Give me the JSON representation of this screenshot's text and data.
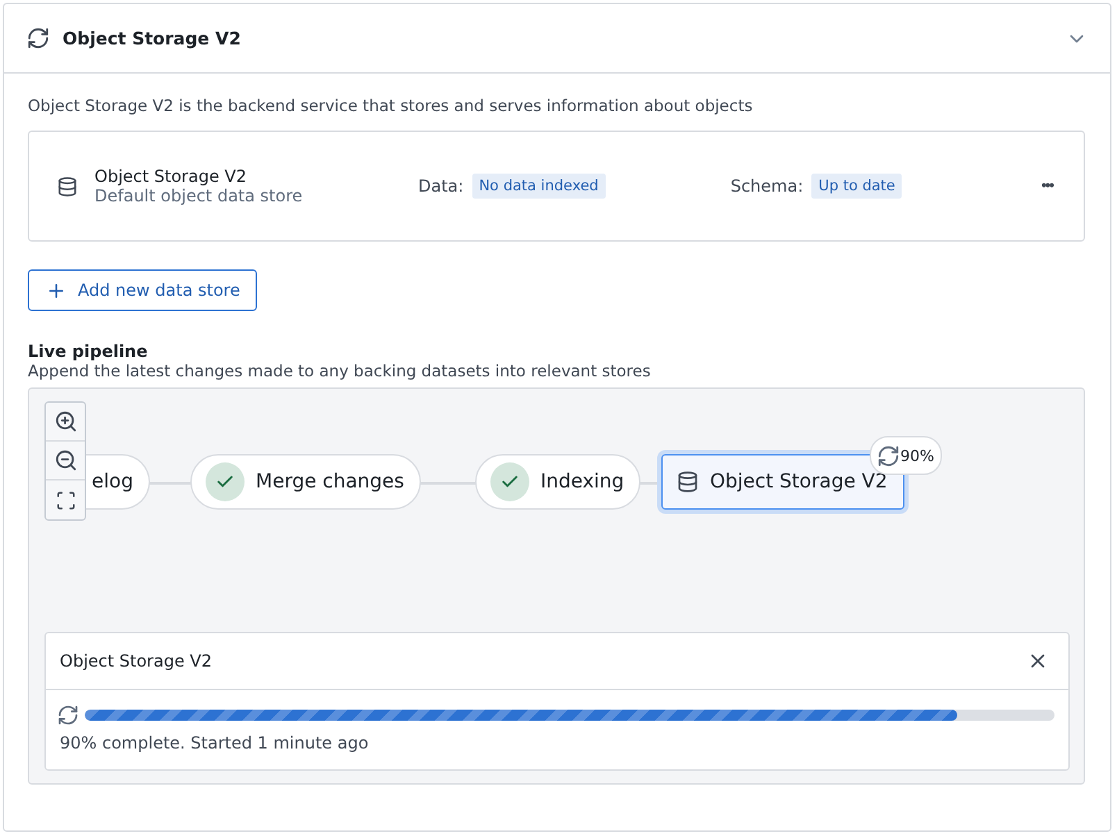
{
  "header": {
    "title": "Object Storage V2",
    "expanded": true
  },
  "description": "Object Storage V2 is the backend service that stores and serves information about objects",
  "stores": [
    {
      "name": "Object Storage V2",
      "subtitle": "Default object data store",
      "data_label": "Data:",
      "data_status": "No data indexed",
      "schema_label": "Schema:",
      "schema_status": "Up to date",
      "menu": "•••"
    }
  ],
  "add_button": "Add new data store",
  "pipeline": {
    "title": "Live pipeline",
    "subtitle": "Append the latest changes made to any backing datasets into relevant stores",
    "nodes": [
      {
        "kind": "step",
        "label": "elog",
        "done": false,
        "selected": false
      },
      {
        "kind": "step",
        "label": "Merge changes",
        "done": true,
        "selected": false
      },
      {
        "kind": "step",
        "label": "Indexing",
        "done": true,
        "selected": false
      },
      {
        "kind": "store",
        "label": "Object Storage V2",
        "done": false,
        "selected": true,
        "badge": "90%"
      }
    ],
    "progress": {
      "title": "Object Storage V2",
      "level": 0.9,
      "status": "90% complete. Started 1 minute ago"
    }
  }
}
